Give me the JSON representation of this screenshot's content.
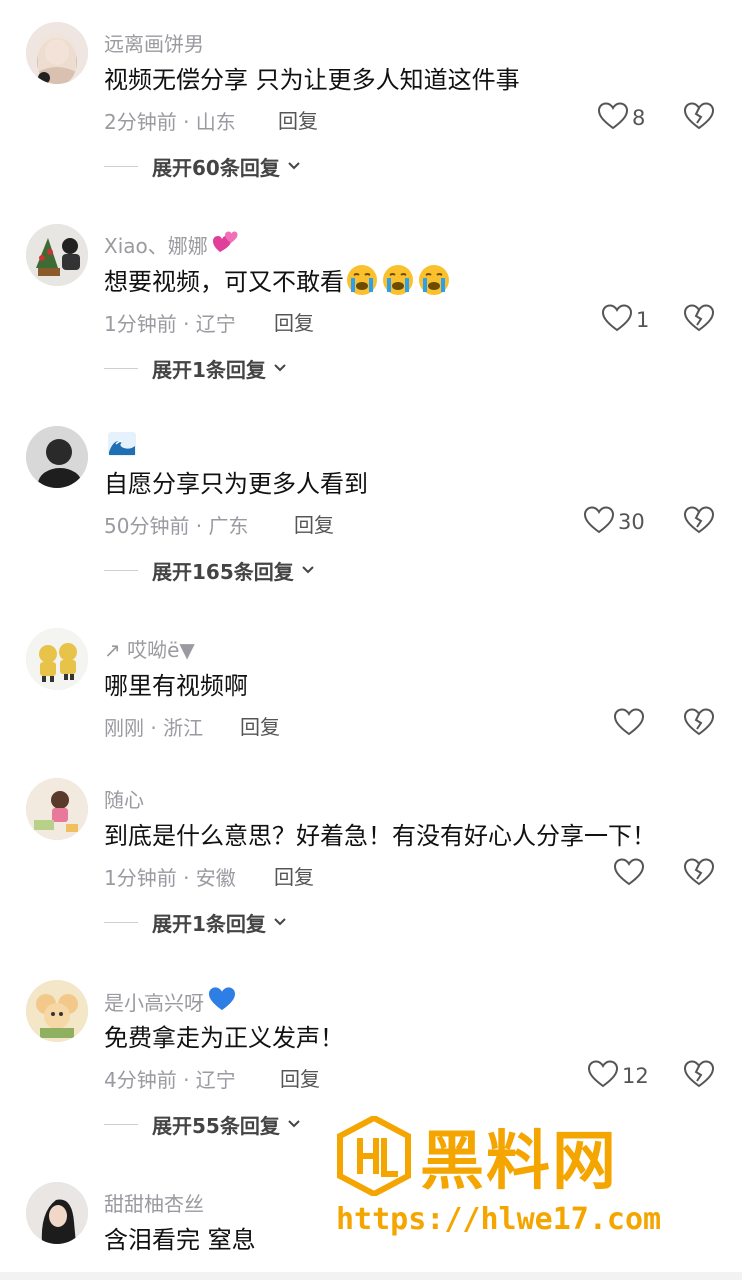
{
  "colors": {
    "accent": "#f5a500",
    "muted": "#9a9aa0",
    "text": "#111111"
  },
  "comments": [
    {
      "username": "远离画饼男",
      "username_emoji": "",
      "text": "视频无偿分享 只为让更多人知道这件事",
      "text_emoji": "",
      "time": "2分钟前",
      "location": "山东",
      "meta": "2分钟前 · 山东",
      "reply_label": "回复",
      "likes": "8",
      "expand_label": "展开60条回复"
    },
    {
      "username": "Xiao、娜娜",
      "username_emoji": "💕",
      "text": "想要视频，可又不敢看",
      "text_emoji": "😭😭😭",
      "time": "1分钟前",
      "location": "辽宁",
      "meta": "1分钟前 · 辽宁",
      "reply_label": "回复",
      "likes": "1",
      "expand_label": "展开1条回复"
    },
    {
      "username": "",
      "username_emoji": "🌊",
      "text": "自愿分享只为更多人看到",
      "text_emoji": "",
      "time": "50分钟前",
      "location": "广东",
      "meta": "50分钟前 · 广东",
      "reply_label": "回复",
      "likes": "30",
      "expand_label": "展开165条回复"
    },
    {
      "username": "↗ 哎呦ë▼",
      "username_emoji": "",
      "text": "哪里有视频啊",
      "text_emoji": "",
      "time": "刚刚",
      "location": "浙江",
      "meta": "刚刚 · 浙江",
      "reply_label": "回复",
      "likes": "",
      "expand_label": ""
    },
    {
      "username": "随心",
      "username_emoji": "",
      "text": "到底是什么意思？好着急！有没有好心人分享一下！",
      "text_emoji": "",
      "time": "1分钟前",
      "location": "安徽",
      "meta": "1分钟前 · 安徽",
      "reply_label": "回复",
      "likes": "",
      "expand_label": "展开1条回复"
    },
    {
      "username": "是小高兴呀",
      "username_emoji": "💙",
      "text": "免费拿走为正义发声！",
      "text_emoji": "",
      "time": "4分钟前",
      "location": "辽宁",
      "meta": "4分钟前 · 辽宁",
      "reply_label": "回复",
      "likes": "12",
      "expand_label": "展开55条回复"
    },
    {
      "username": "甜甜柚杏丝",
      "username_emoji": "",
      "text": "含泪看完 窒息",
      "text_emoji": "",
      "time": "",
      "location": "",
      "meta": "",
      "reply_label": "",
      "likes": "",
      "expand_label": ""
    }
  ],
  "watermark": {
    "brand": "黑料网",
    "url": "https://hlwe17.com"
  },
  "icons": {
    "like": "heart-outline-icon",
    "dislike": "broken-heart-icon",
    "expand": "chevron-down-icon"
  }
}
